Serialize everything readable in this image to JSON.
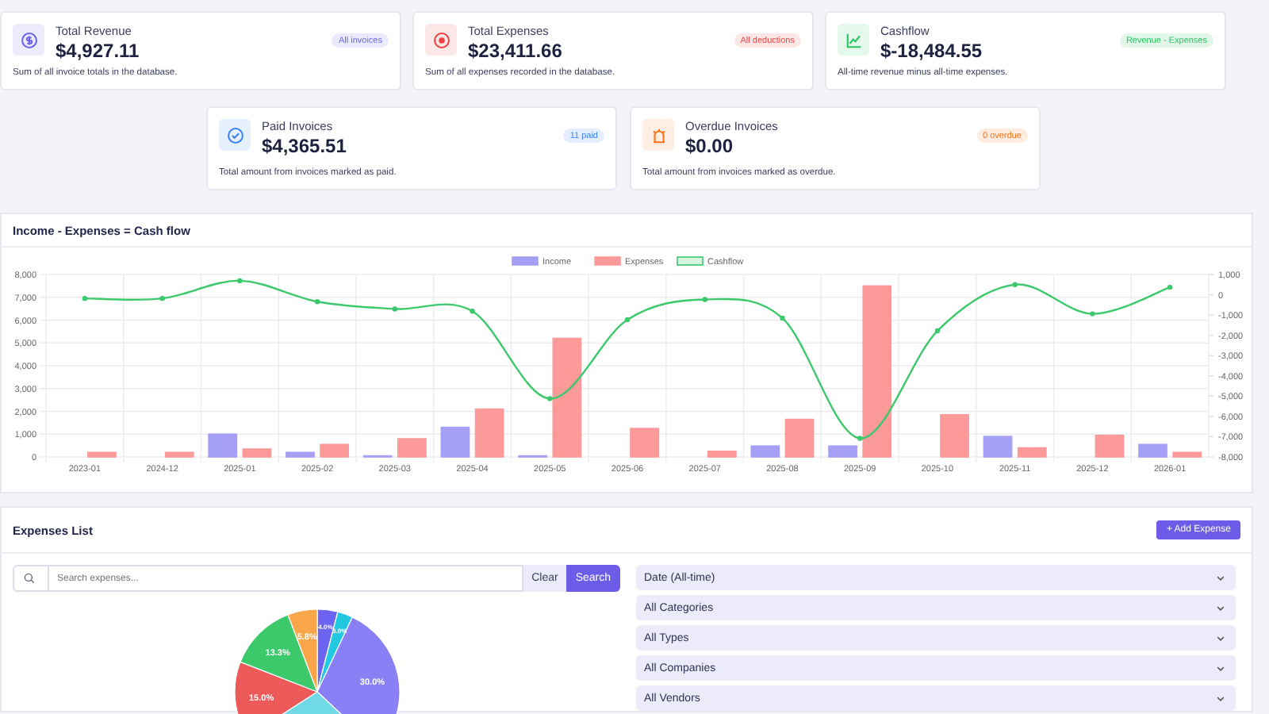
{
  "summary_cards": [
    {
      "title": "Total Revenue",
      "value": "$4,927.11",
      "badge": "All invoices",
      "description": "Sum of all invoice totals in the database.",
      "color": "#6c63f0"
    },
    {
      "title": "Total Expenses",
      "value": "$23,411.66",
      "badge": "All deductions",
      "description": "Sum of all expenses recorded in the database.",
      "color": "#ef4444"
    },
    {
      "title": "Cashflow",
      "value": "$-18,484.55",
      "badge": "Revenue - Expenses",
      "description": "All-time revenue minus all-time expenses.",
      "color": "#22c55e"
    },
    {
      "title": "Paid Invoices",
      "value": "$4,365.51",
      "badge": "11 paid",
      "description": "Total amount from invoices marked as paid.",
      "color": "#3b82f6"
    },
    {
      "title": "Overdue Invoices",
      "value": "$0.00",
      "badge": "0 overdue",
      "description": "Total amount from invoices marked as overdue.",
      "color": "#f97316"
    }
  ],
  "cashflow_panel": {
    "title": "Income - Expenses = Cash flow",
    "chart_data": {
      "type": "bar",
      "grid": true,
      "legend": "top",
      "categories": [
        "2023-01",
        "2024-12",
        "2025-01",
        "2025-02",
        "2025-03",
        "2025-04",
        "2025-05",
        "2025-06",
        "2025-07",
        "2025-08",
        "2025-09",
        "2025-10",
        "2025-11",
        "2025-12",
        "2026-01"
      ],
      "series": [
        {
          "name": "Income",
          "color": "#a5a0f5",
          "type": "bar",
          "values": [
            0,
            0,
            1000,
            200,
            50,
            1300,
            50,
            0,
            0,
            480,
            480,
            0,
            900,
            0,
            550
          ]
        },
        {
          "name": "Expenses",
          "color": "#fc9a9a",
          "type": "bar",
          "values": [
            200,
            200,
            350,
            550,
            800,
            2100,
            5200,
            1250,
            250,
            1650,
            7500,
            1850,
            400,
            950,
            200
          ]
        },
        {
          "name": "Cashflow",
          "color": "#3cc96b",
          "type": "line",
          "axis": "y2",
          "marker": true,
          "values": [
            -180,
            -180,
            690,
            -340,
            -700,
            -810,
            -5120,
            -1230,
            -230,
            -1150,
            -7080,
            -1780,
            500,
            -940,
            370
          ]
        }
      ],
      "ylim": [
        0,
        8000
      ],
      "yticks": [
        {
          "value": 0,
          "label": "0"
        },
        {
          "value": 1000,
          "label": "1,000"
        },
        {
          "value": 2000,
          "label": "2,000"
        },
        {
          "value": 3000,
          "label": "3,000"
        },
        {
          "value": 4000,
          "label": "4,000"
        },
        {
          "value": 5000,
          "label": "5,000"
        },
        {
          "value": 6000,
          "label": "6,000"
        },
        {
          "value": 7000,
          "label": "7,000"
        },
        {
          "value": 8000,
          "label": "8,000"
        }
      ],
      "y2lim": [
        -8000,
        1000
      ],
      "y2ticks": [
        {
          "value": -8000,
          "label": "-8,000"
        },
        {
          "value": -7000,
          "label": "-7,000"
        },
        {
          "value": -6000,
          "label": "-6,000"
        },
        {
          "value": -5000,
          "label": "-5,000"
        },
        {
          "value": -4000,
          "label": "-4,000"
        },
        {
          "value": -3000,
          "label": "-3,000"
        },
        {
          "value": -2000,
          "label": "-2,000"
        },
        {
          "value": -1000,
          "label": "-1,000"
        },
        {
          "value": 0,
          "label": "0"
        },
        {
          "value": 1000,
          "label": "1,000"
        }
      ]
    }
  },
  "expenses_panel": {
    "title": "Expenses List",
    "add_button": "+ Add Expense",
    "search": {
      "placeholder": "Search expenses...",
      "clear": "Clear",
      "submit": "Search"
    },
    "chart_data": {
      "type": "pie",
      "values": [
        4.0,
        3.0,
        30.0,
        28.9,
        15.0,
        13.3,
        5.8
      ],
      "colors": [
        "#6c63f0",
        "#22c7e0",
        "#8a80f5",
        "#6fd9e6",
        "#ec5a5a",
        "#3cc96b",
        "#f9a54a"
      ],
      "value_labels": [
        "4.0%",
        "3.0%",
        "30.0%",
        null,
        "15.0%",
        "13.3%",
        "5.8%"
      ]
    },
    "filters": [
      "Date (All-time)",
      "All Categories",
      "All Types",
      "All Companies",
      "All Vendors"
    ]
  }
}
